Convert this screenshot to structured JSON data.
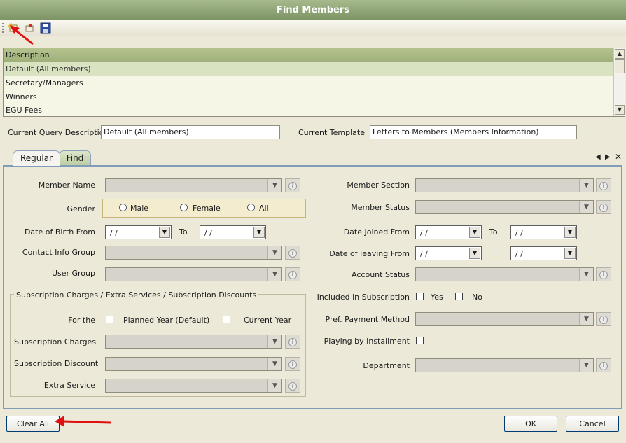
{
  "window": {
    "title": "Find Members"
  },
  "toolbar": {
    "icons": [
      "new-icon",
      "delete-icon",
      "save-icon"
    ]
  },
  "query_list": {
    "header": "Description",
    "items": [
      "Default (All members)",
      "Secretary/Managers",
      "Winners",
      "EGU Fees"
    ],
    "selected_index": 0
  },
  "current_query": {
    "label": "Current Query Description",
    "value": "Default (All members)"
  },
  "current_template": {
    "label": "Current Template",
    "value": "Letters to Members   (Members Information)"
  },
  "tabs": [
    {
      "label": "Regular",
      "active": true
    },
    {
      "label": "Find",
      "active": false
    }
  ],
  "form": {
    "member_name": {
      "label": "Member Name"
    },
    "gender": {
      "label": "Gender",
      "options": [
        "Male",
        "Female",
        "All"
      ]
    },
    "dob_from": {
      "label": "Date of Birth From",
      "from_value": " / /",
      "to_label": "To",
      "to_value": " / /"
    },
    "contact_info_group": {
      "label": "Contact Info Group"
    },
    "user_group": {
      "label": "User Group"
    },
    "subscription_group": {
      "title": "Subscription Charges / Extra Services /  Subscription Discounts",
      "for_the_label": "For the",
      "planned_year_label": "Planned Year (Default)",
      "current_year_label": "Current Year",
      "subscription_charges_label": "Subscription Charges",
      "subscription_discount_label": "Subscription Discount",
      "extra_service_label": "Extra Service"
    },
    "member_section": {
      "label": "Member Section"
    },
    "member_status": {
      "label": "Member Status"
    },
    "date_joined_from": {
      "label": "Date Joined From",
      "from_value": " / /",
      "to_label": "To",
      "to_value": " / /"
    },
    "date_leaving_from": {
      "label": "Date of leaving From",
      "from_value": " / /",
      "to_value": " / /"
    },
    "account_status": {
      "label": "Account Status"
    },
    "included_in_subscription": {
      "label": "Included in Subscription",
      "yes_label": "Yes",
      "no_label": "No"
    },
    "pref_payment_method": {
      "label": "Pref. Payment Method"
    },
    "playing_by_installment": {
      "label": "Playing by Installment"
    },
    "department": {
      "label": "Department"
    }
  },
  "buttons": {
    "clear_all": "Clear All",
    "ok": "OK",
    "cancel": "Cancel"
  },
  "colors": {
    "title_bar": "#8ba472",
    "header_row": "#a7b883",
    "annotation_arrow": "#e01010"
  }
}
